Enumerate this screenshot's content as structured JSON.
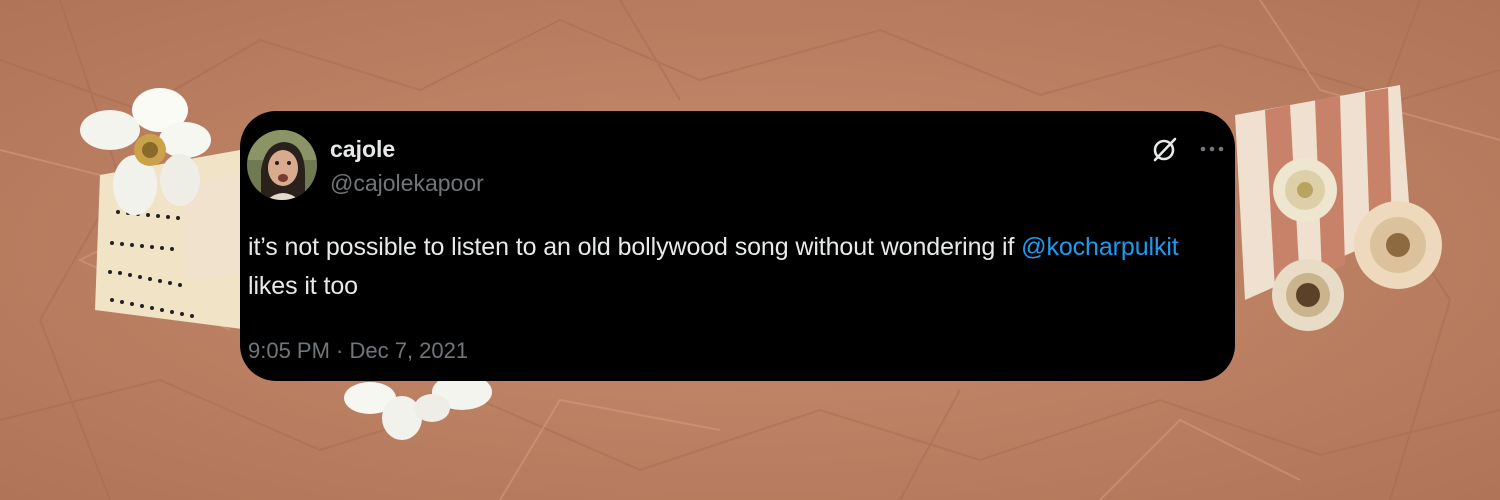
{
  "tweet": {
    "display_name": "cajole",
    "handle": "@cajolekapoor",
    "text_before": "it’s not possible to listen to an old bollywood song without wondering if ",
    "mention": "@kocharpulkit",
    "text_after": " likes it too",
    "timestamp": "9:05 PM · Dec 7, 2021"
  },
  "icons": {
    "grok": "grok-icon",
    "more": "more-icon",
    "avatar": "avatar"
  },
  "colors": {
    "background": "#c08466",
    "card": "#000000",
    "text": "#e7e9ea",
    "secondary": "#71767b",
    "link": "#1d9bf0"
  }
}
